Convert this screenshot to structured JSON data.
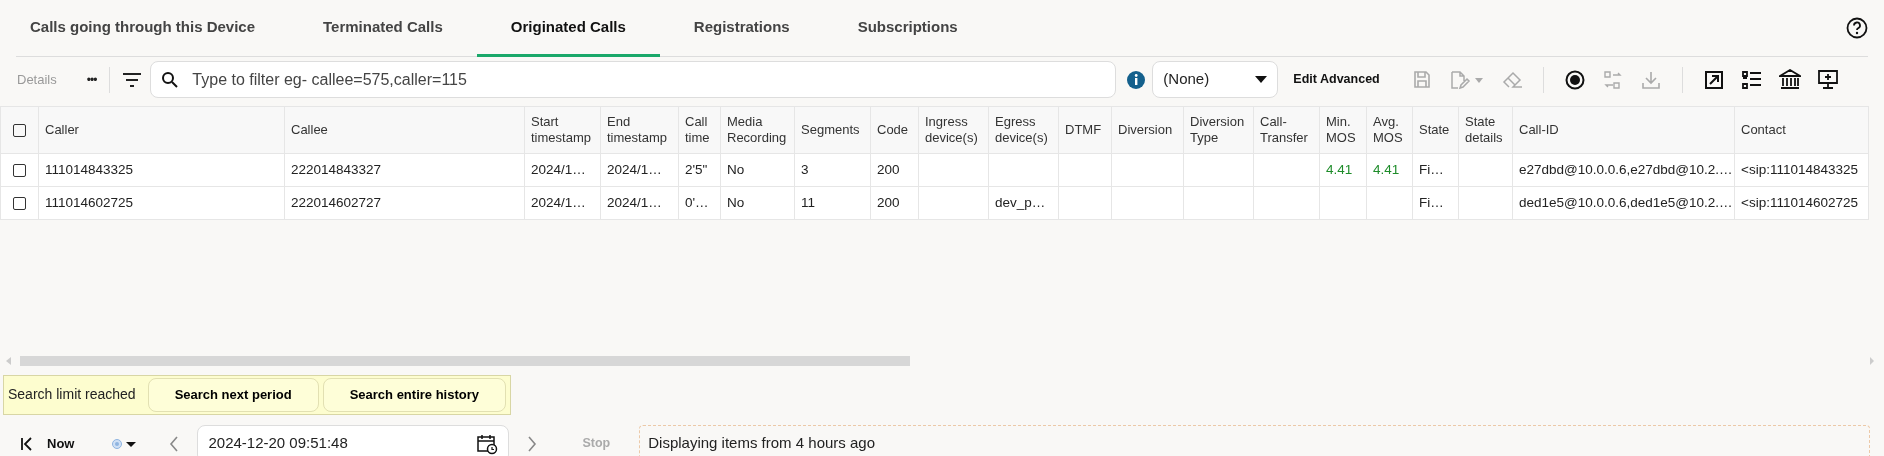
{
  "tabs": [
    {
      "label": "Calls going through this Device",
      "selected": false
    },
    {
      "label": "Terminated Calls",
      "selected": false
    },
    {
      "label": "Originated Calls",
      "selected": true
    },
    {
      "label": "Registrations",
      "selected": false
    },
    {
      "label": "Subscriptions",
      "selected": false
    }
  ],
  "toolbar": {
    "details_label": "Details",
    "more_label": "•••",
    "filter": {
      "placeholder": "Type to filter eg- callee=575,caller=115"
    },
    "select_value": "(None)",
    "edit_advanced": "Edit Advanced",
    "tools": [
      {
        "kind": "save",
        "disabled": true
      },
      {
        "kind": "edit",
        "disabled": true
      },
      {
        "kind": "eraser",
        "disabled": true
      },
      {
        "kind": "separator"
      },
      {
        "kind": "record",
        "disabled": false
      },
      {
        "kind": "swap",
        "disabled": true
      },
      {
        "kind": "download",
        "disabled": true
      },
      {
        "kind": "separator"
      },
      {
        "kind": "export",
        "disabled": false
      },
      {
        "kind": "list",
        "disabled": false
      },
      {
        "kind": "bank",
        "disabled": false
      },
      {
        "kind": "add-screen",
        "disabled": false
      }
    ]
  },
  "table": {
    "all_checked": false,
    "columns": [
      {
        "label": "Caller"
      },
      {
        "label": "Callee"
      },
      {
        "label": "Start timestamp"
      },
      {
        "label": "End timestamp"
      },
      {
        "label": "Call time"
      },
      {
        "label": "Media Recording"
      },
      {
        "label": "Segments"
      },
      {
        "label": "Code"
      },
      {
        "label": "Ingress device(s)"
      },
      {
        "label": "Egress device(s)"
      },
      {
        "label": "DTMF"
      },
      {
        "label": "Diversion"
      },
      {
        "label": "Diversion Type"
      },
      {
        "label": "Call-Transfer"
      },
      {
        "label": "Min. MOS",
        "kind": "mos"
      },
      {
        "label": "Avg. MOS",
        "kind": "mos"
      },
      {
        "label": "State"
      },
      {
        "label": "State details"
      },
      {
        "label": "Call-ID"
      },
      {
        "label": "Contact"
      }
    ],
    "rows": [
      {
        "checked": false,
        "cells": [
          "111014843325",
          "222014843327",
          "2024/1…",
          "2024/1…",
          "2'5\"",
          "No",
          "3",
          "200",
          null,
          null,
          null,
          null,
          null,
          null,
          "4.41",
          "4.41",
          "Fi…",
          null,
          "e27dbd@10.0.0.6,e27dbd@10.2.…",
          "<sip:111014843325"
        ]
      },
      {
        "checked": false,
        "cells": [
          "111014602725",
          "222014602727",
          "2024/1…",
          "2024/1…",
          "0'…",
          "No",
          "11",
          "200",
          null,
          "dev_p…",
          null,
          null,
          null,
          null,
          null,
          null,
          "Fi…",
          null,
          "ded1e5@10.0.0.6,ded1e5@10.2.…",
          "<sip:111014602725"
        ]
      }
    ]
  },
  "search_limit": {
    "message": "Search limit reached",
    "buttons": [
      "Search next period",
      "Search entire history"
    ]
  },
  "bottom": {
    "now_label": "Now",
    "date_value": "2024-12-20 09:51:48",
    "stop_label": "Stop",
    "status": "Displaying items from 4 hours ago"
  }
}
